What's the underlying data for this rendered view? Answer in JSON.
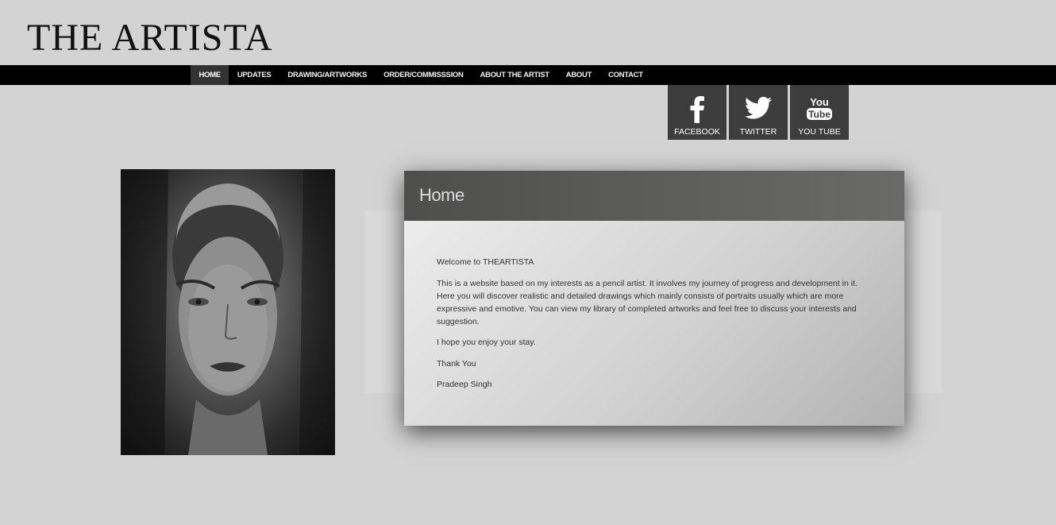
{
  "site": {
    "logo_text": "THE ARTISTA"
  },
  "nav": {
    "items": [
      {
        "label": "HOME",
        "active": true
      },
      {
        "label": "UPDATES",
        "active": false
      },
      {
        "label": "DRAWING/ARTWORKS",
        "active": false
      },
      {
        "label": "ORDER/COMMISSSION",
        "active": false
      },
      {
        "label": "ABOUT THE ARTIST",
        "active": false
      },
      {
        "label": "ABOUT",
        "active": false
      },
      {
        "label": "CONTACT",
        "active": false
      }
    ]
  },
  "social": {
    "facebook": {
      "label": "FACEBOOK",
      "icon": "facebook-icon"
    },
    "twitter": {
      "label": "TWITTER",
      "icon": "twitter-icon"
    },
    "youtube": {
      "label": "YOU TUBE",
      "icon": "youtube-icon",
      "icon_text_top": "You",
      "icon_text_bottom": "Tube"
    }
  },
  "main": {
    "title": "Home",
    "paragraphs": [
      "Welcome to THEARTISTA",
      "This is a website based on my interests as a pencil artist. It involves my journey of progress and development in it. Here you will discover realistic and detailed drawings which mainly consists of portraits usually which are more expressive and emotive. You can view my library of completed artworks and feel free to discuss your interests and suggestion.",
      "I hope you enjoy your stay.",
      "Thank You",
      "Pradeep Singh"
    ]
  },
  "colors": {
    "background": "#d3d3d3",
    "navbar": "#000000",
    "nav_active": "#333333",
    "social_button": "#3d3d3d",
    "content_header": "#5a5a59"
  }
}
